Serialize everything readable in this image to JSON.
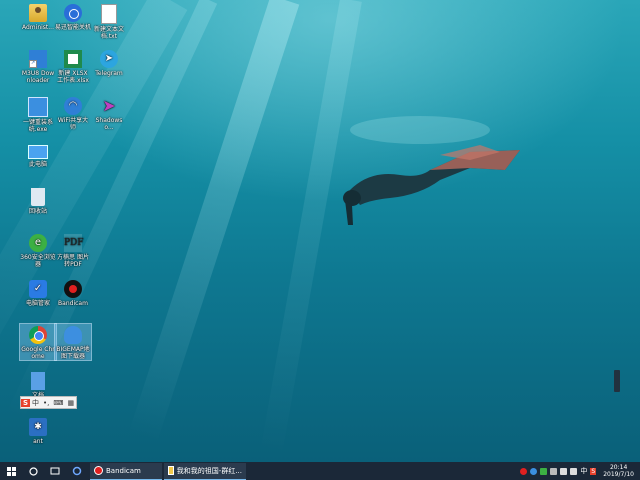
{
  "desktop": {
    "icons": [
      {
        "label": "Administ..."
      },
      {
        "label": "易迅智能关机"
      },
      {
        "label": "新建文本文档.txt"
      },
      {
        "label": "M3U8 Downloader"
      },
      {
        "label": "新建 XLSX 工作表.xlsx"
      },
      {
        "label": "Telegram"
      },
      {
        "label": "一键重装系统.exe"
      },
      {
        "label": "WiFi共享大师"
      },
      {
        "label": "Shadowso..."
      },
      {
        "label": "此电脑"
      },
      {
        "label": "回收站"
      },
      {
        "label": "360安全浏览器"
      },
      {
        "label": "方楠思 图片转PDF"
      },
      {
        "label": "电脑管家"
      },
      {
        "label": "Bandicam"
      },
      {
        "label": "Google Chrome"
      },
      {
        "label": "BIGEMAP地图下载器"
      },
      {
        "label": "文档"
      },
      {
        "label": "ant"
      }
    ]
  },
  "ime": {
    "s": "S",
    "lang": "中",
    "punct": "•,",
    "kbd": "⌨",
    "skin": "▦"
  },
  "taskbar": {
    "apps": [
      {
        "label": "Bandicam"
      },
      {
        "label": "我和我的祖国-群红..."
      }
    ],
    "tray": {
      "ime": "中",
      "sogou": "S"
    },
    "clock": {
      "time": "20:14",
      "date": "2019/7/10"
    }
  }
}
